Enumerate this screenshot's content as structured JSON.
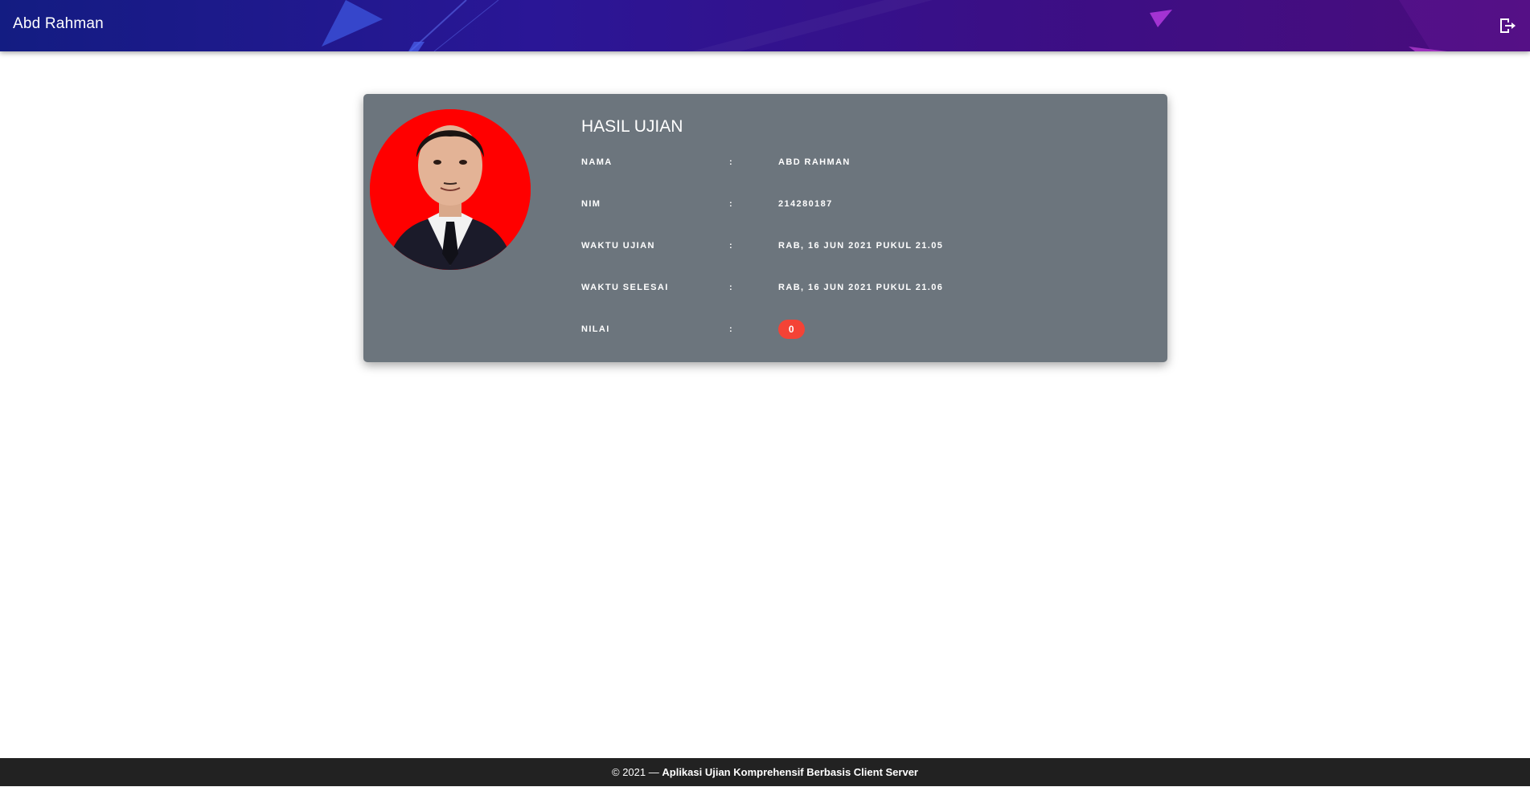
{
  "header": {
    "brand": "Abd Rahman",
    "logout_icon": "logout-icon"
  },
  "result": {
    "title": "HASIL UJIAN",
    "photo_icon": "user-photo",
    "rows": [
      {
        "label": "NAMA",
        "colon": ":",
        "value": "ABD RAHMAN"
      },
      {
        "label": "NIM",
        "colon": ":",
        "value": "214280187"
      },
      {
        "label": "WAKTU UJIAN",
        "colon": ":",
        "value": "RAB, 16 JUN 2021 PUKUL 21.05"
      },
      {
        "label": "WAKTU SELESAI",
        "colon": ":",
        "value": "RAB, 16 JUN 2021 PUKUL 21.06"
      },
      {
        "label": "NILAI",
        "colon": ":",
        "value": "0"
      }
    ]
  },
  "footer": {
    "prefix": "© 2021 —",
    "app_name": "Aplikasi Ujian Komprehensif Berbasis Client Server"
  },
  "colors": {
    "header_start": "#131c82",
    "header_end": "#4a0c7c",
    "card_bg": "#6c757d",
    "score_badge": "#f44336",
    "footer_bg": "#222222"
  }
}
